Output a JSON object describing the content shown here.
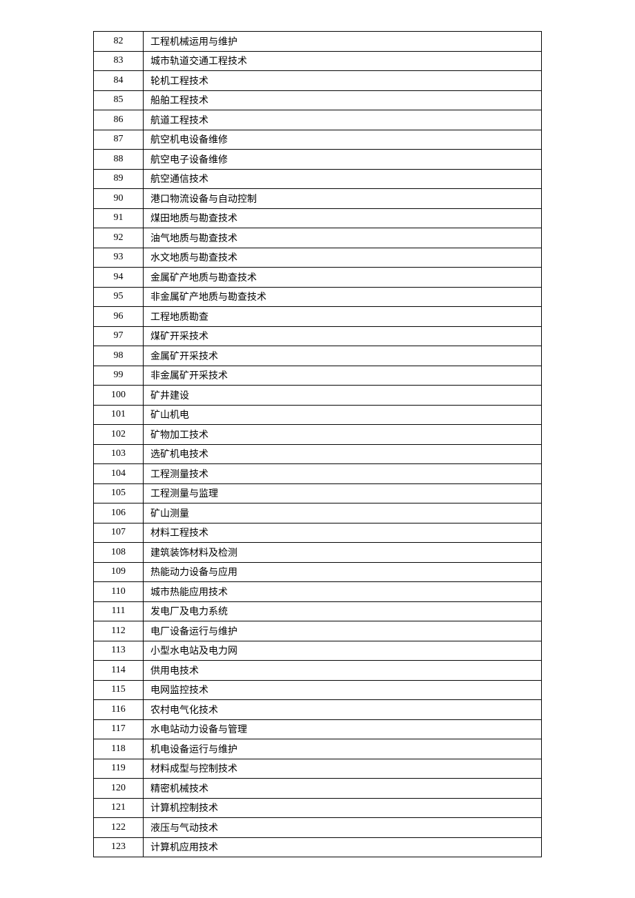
{
  "table": {
    "rows": [
      {
        "num": "82",
        "name": "工程机械运用与维护"
      },
      {
        "num": "83",
        "name": "城市轨道交通工程技术"
      },
      {
        "num": "84",
        "name": "轮机工程技术"
      },
      {
        "num": "85",
        "name": "船舶工程技术"
      },
      {
        "num": "86",
        "name": "航道工程技术"
      },
      {
        "num": "87",
        "name": "航空机电设备维修"
      },
      {
        "num": "88",
        "name": "航空电子设备维修"
      },
      {
        "num": "89",
        "name": "航空通信技术"
      },
      {
        "num": "90",
        "name": "港口物流设备与自动控制"
      },
      {
        "num": "91",
        "name": "煤田地质与勘查技术"
      },
      {
        "num": "92",
        "name": "油气地质与勘查技术"
      },
      {
        "num": "93",
        "name": "水文地质与勘查技术"
      },
      {
        "num": "94",
        "name": "金属矿产地质与勘查技术"
      },
      {
        "num": "95",
        "name": "非金属矿产地质与勘查技术"
      },
      {
        "num": "96",
        "name": "工程地质勘查"
      },
      {
        "num": "97",
        "name": "煤矿开采技术"
      },
      {
        "num": "98",
        "name": "金属矿开采技术"
      },
      {
        "num": "99",
        "name": "非金属矿开采技术"
      },
      {
        "num": "100",
        "name": "矿井建设"
      },
      {
        "num": "101",
        "name": "矿山机电"
      },
      {
        "num": "102",
        "name": "矿物加工技术"
      },
      {
        "num": "103",
        "name": "选矿机电技术"
      },
      {
        "num": "104",
        "name": "工程测量技术"
      },
      {
        "num": "105",
        "name": "工程测量与监理"
      },
      {
        "num": "106",
        "name": "矿山测量"
      },
      {
        "num": "107",
        "name": "材料工程技术"
      },
      {
        "num": "108",
        "name": "建筑装饰材料及检测"
      },
      {
        "num": "109",
        "name": "热能动力设备与应用"
      },
      {
        "num": "110",
        "name": "城市热能应用技术"
      },
      {
        "num": "111",
        "name": "发电厂及电力系统"
      },
      {
        "num": "112",
        "name": "电厂设备运行与维护"
      },
      {
        "num": "113",
        "name": "小型水电站及电力网"
      },
      {
        "num": "114",
        "name": "供用电技术"
      },
      {
        "num": "115",
        "name": "电网监控技术"
      },
      {
        "num": "116",
        "name": "农村电气化技术"
      },
      {
        "num": "117",
        "name": "水电站动力设备与管理"
      },
      {
        "num": "118",
        "name": "机电设备运行与维护"
      },
      {
        "num": "119",
        "name": "材料成型与控制技术"
      },
      {
        "num": "120",
        "name": "精密机械技术"
      },
      {
        "num": "121",
        "name": "计算机控制技术"
      },
      {
        "num": "122",
        "name": "液压与气动技术"
      },
      {
        "num": "123",
        "name": "计算机应用技术"
      }
    ]
  }
}
